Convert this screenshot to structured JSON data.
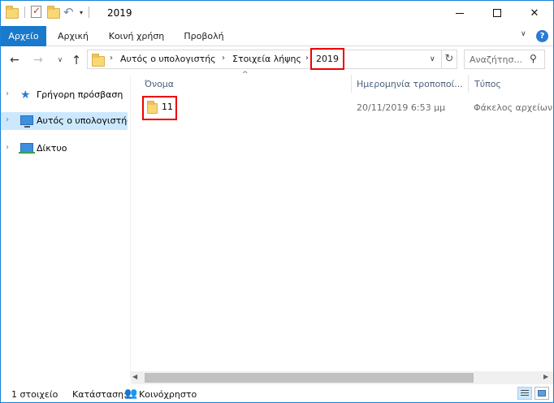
{
  "window": {
    "title": "2019"
  },
  "ribbon": {
    "tabs": [
      "Αρχείο",
      "Αρχική",
      "Κοινή χρήση",
      "Προβολή"
    ],
    "help_label": "?"
  },
  "address": {
    "crumbs": [
      "Αυτός ο υπολογιστής",
      "Στοιχεία λήψης",
      "2019"
    ]
  },
  "search": {
    "placeholder": "Αναζήτησ..."
  },
  "navigation": {
    "items": [
      {
        "label": "Γρήγορη πρόσβαση",
        "icon": "star-icon"
      },
      {
        "label": "Αυτός ο υπολογιστής",
        "icon": "computer-icon",
        "selected": true
      },
      {
        "label": "Δίκτυο",
        "icon": "network-icon"
      }
    ]
  },
  "file_list": {
    "columns": [
      "Όνομα",
      "Ημερομηνία τροποποί...",
      "Τύπος"
    ],
    "rows": [
      {
        "name": "11",
        "date": "20/11/2019 6:53 μμ",
        "type": "Φάκελος αρχείων"
      }
    ]
  },
  "status_bar": {
    "count": "1 στοιχείο",
    "state_label": "Κατάσταση:",
    "state_value": "Κοινόχρηστο"
  },
  "colors": {
    "accent": "#1979ca",
    "selection": "#cce8ff",
    "highlight_border": "#e00000",
    "folder": "#f8d775"
  }
}
